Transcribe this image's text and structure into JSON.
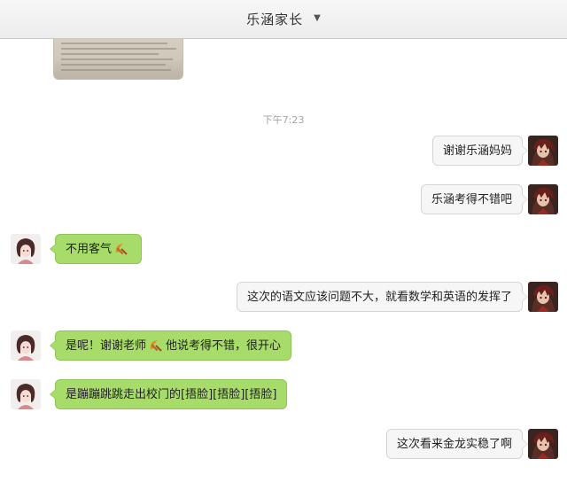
{
  "window": {
    "title": "乐涵家长"
  },
  "timestamp": "下午7:23",
  "colors": {
    "own_bubble": "#f6f6f6",
    "other_bubble": "#a7db6a",
    "timestamp_text": "#a3a3a3"
  },
  "messages": [
    {
      "side": "right",
      "text": "谢谢乐涵妈妈"
    },
    {
      "side": "right",
      "text": "乐涵考得不错吧"
    },
    {
      "side": "left",
      "text": "不用客气",
      "emoji": "sickle-emoji"
    },
    {
      "side": "right",
      "text": "这次的语文应该问题不大，就看数学和英语的发挥了"
    },
    {
      "side": "left",
      "text_before": "是呢！谢谢老师",
      "emoji": "sickle-emoji",
      "text_after": "他说考得不错，很开心"
    },
    {
      "side": "left",
      "text": "是蹦蹦跳跳走出校门的[捂脸][捂脸][捂脸]"
    },
    {
      "side": "right",
      "text": "这次看来金龙实稳了啊"
    }
  ]
}
